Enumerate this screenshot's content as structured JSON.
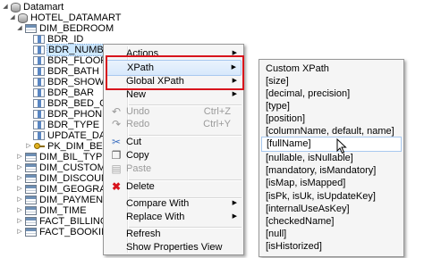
{
  "tree": {
    "nodes": [
      {
        "label": "Datamart",
        "icon": "database-icon"
      },
      {
        "label": "HOTEL_DATAMART",
        "icon": "database-icon"
      },
      {
        "label": "DIM_BEDROOM",
        "icon": "table-icon"
      },
      {
        "label": "BDR_ID",
        "icon": "column-icon"
      },
      {
        "label": "BDR_NUMBER",
        "icon": "column-icon"
      },
      {
        "label": "BDR_FLOOR",
        "icon": "column-icon"
      },
      {
        "label": "BDR_BATH",
        "icon": "column-icon"
      },
      {
        "label": "BDR_SHOWER",
        "icon": "column-icon"
      },
      {
        "label": "BDR_BAR",
        "icon": "column-icon"
      },
      {
        "label": "BDR_BED_COU",
        "icon": "column-icon"
      },
      {
        "label": "BDR_PHONE_N",
        "icon": "column-icon"
      },
      {
        "label": "BDR_TYPE",
        "icon": "column-icon"
      },
      {
        "label": "UPDATE_DATE",
        "icon": "column-icon"
      },
      {
        "label": "PK_DIM_BEDRO",
        "icon": "key-icon"
      },
      {
        "label": "DIM_BIL_TYPE",
        "icon": "table-icon"
      },
      {
        "label": "DIM_CUSTOMER",
        "icon": "table-icon"
      },
      {
        "label": "DIM_DISCOUNT",
        "icon": "table-icon"
      },
      {
        "label": "DIM_GEOGRAPHY",
        "icon": "table-icon"
      },
      {
        "label": "DIM_PAYMENT_TY",
        "icon": "table-icon"
      },
      {
        "label": "DIM_TIME",
        "icon": "table-icon"
      },
      {
        "label": "FACT_BILLING",
        "icon": "table-icon"
      },
      {
        "label": "FACT_BOOKING",
        "icon": "table-icon"
      }
    ]
  },
  "context_menu": {
    "actions": "Actions",
    "xpath": "XPath",
    "global_xpath": "Global XPath",
    "new": "New",
    "undo": "Undo",
    "undo_sc": "Ctrl+Z",
    "redo": "Redo",
    "redo_sc": "Ctrl+Y",
    "cut": "Cut",
    "copy": "Copy",
    "paste": "Paste",
    "delete": "Delete",
    "compare_with": "Compare With",
    "replace_with": "Replace With",
    "refresh": "Refresh",
    "show_properties": "Show Properties View"
  },
  "xpath_submenu": {
    "items": [
      "Custom XPath",
      "[size]",
      "[decimal, precision]",
      "[type]",
      "[position]",
      "[columnName, default, name]",
      "[fullName]",
      "[nullable, isNullable]",
      "[mandatory, isMandatory]",
      "[isMap, isMapped]",
      "[isPk, isUk, isUpdateKey]",
      "[internalUseAsKey]",
      "[checkedName]",
      "[null]",
      "[isHistorized]"
    ],
    "highlighted": "[fullName]"
  },
  "colors": {
    "highlight_box": "#d8141c",
    "selection": "#cde8ff",
    "menu_bg": "#f5f5f5"
  }
}
